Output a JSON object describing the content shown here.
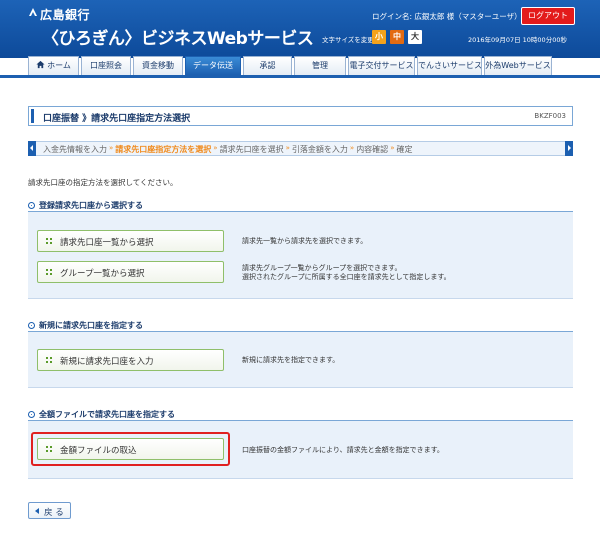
{
  "header": {
    "bank_name": "広島銀行",
    "service_name": "〈ひろぎん〉ビジネスWebサービス",
    "login_info": "ログイン名: 広銀太郎 様（マスターユーザ）",
    "logout_label": "ログアウト",
    "font_size_label": "文字サイズを変更",
    "font_size_small": "小",
    "font_size_medium": "中",
    "font_size_large": "大",
    "datetime": "2016年09月07日 10時00分00秒"
  },
  "nav": {
    "tabs": [
      {
        "label": "ホーム",
        "icon": "home-icon"
      },
      {
        "label": "口座照会"
      },
      {
        "label": "資金移動"
      },
      {
        "label": "データ伝送",
        "active": true
      },
      {
        "label": "承認"
      },
      {
        "label": "管理"
      },
      {
        "label": "電子交付サービス"
      },
      {
        "label": "でんさいサービス"
      },
      {
        "label": "外為Webサービス"
      }
    ]
  },
  "page": {
    "title": "口座振替 》請求先口座指定方法選択",
    "screen_code": "BKZF003",
    "instruction": "請求先口座の指定方法を選択してください。"
  },
  "steps": [
    {
      "label": "入金先情報を入力"
    },
    {
      "label": "請求先口座指定方法を選択",
      "current": true
    },
    {
      "label": "請求先口座を選択"
    },
    {
      "label": "引落金額を入力"
    },
    {
      "label": "内容確認"
    },
    {
      "label": "確定"
    }
  ],
  "sections": {
    "registered": {
      "title": "登録請求先口座から選択する",
      "option1_label": "請求先口座一覧から選択",
      "option1_desc": "請求先一覧から請求先を選択できます。",
      "option2_label": "グループ一覧から選択",
      "option2_desc_line1": "請求先グループ一覧からグループを選択できます。",
      "option2_desc_line2": "選択されたグループに所属する全口座を請求先として指定します。"
    },
    "new": {
      "title": "新規に請求先口座を指定する",
      "option_label": "新規に請求先口座を入力",
      "option_desc": "新規に請求先を指定できます。"
    },
    "file": {
      "title": "全額ファイルで請求先口座を指定する",
      "option_label": "金額ファイルの取込",
      "option_desc": "口座振替の金額ファイルにより、請求先と金額を指定できます。"
    }
  },
  "footer": {
    "back_label": "戻 る"
  },
  "colors": {
    "header_blue": "#1c5fb0",
    "logout_red": "#e31b1b",
    "step_current": "#f08a1c",
    "button_border_green": "#8fbf6a",
    "highlight_red": "#e02020"
  }
}
